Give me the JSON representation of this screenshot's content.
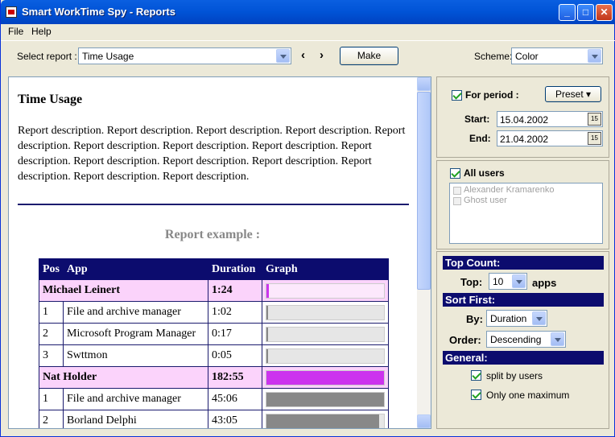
{
  "window": {
    "title": "Smart WorkTime Spy - Reports"
  },
  "menu": [
    "File",
    "Help"
  ],
  "toolbar": {
    "select_report_label": "Select report :",
    "report_value": "Time Usage",
    "prev_label": "‹",
    "next_label": "›",
    "make_label": "Make",
    "scheme_label": "Scheme:",
    "scheme_value": "Color"
  },
  "report": {
    "title": "Time Usage",
    "description": "Report description. Report description. Report description. Report description. Report description. Report description. Report description. Report description. Report description. Report description. Report description. Report description. Report description. Report description. Report description.",
    "example_title": "Report example :",
    "columns": [
      "Pos",
      "App",
      "Duration",
      "Graph"
    ],
    "rows": [
      {
        "type": "user",
        "pos": "",
        "app": "Michael Leinert",
        "duration": "1:24",
        "graph_fraction": 0.02,
        "color": "#cc33ee"
      },
      {
        "type": "app",
        "pos": "1",
        "app": "File and archive manager",
        "duration": "1:02",
        "graph_fraction": 0.01,
        "color": "#888888"
      },
      {
        "type": "app",
        "pos": "2",
        "app": "Microsoft Program Manager",
        "duration": "0:17",
        "graph_fraction": 0.01,
        "color": "#888888"
      },
      {
        "type": "app",
        "pos": "3",
        "app": "Swttmon",
        "duration": "0:05",
        "graph_fraction": 0.01,
        "color": "#888888"
      },
      {
        "type": "user",
        "pos": "",
        "app": "Nat Holder",
        "duration": "182:55",
        "graph_fraction": 1.0,
        "color": "#cc33ee"
      },
      {
        "type": "app",
        "pos": "1",
        "app": "File and archive manager",
        "duration": "45:06",
        "graph_fraction": 1.0,
        "color": "#888888"
      },
      {
        "type": "app",
        "pos": "2",
        "app": "Borland Delphi",
        "duration": "43:05",
        "graph_fraction": 0.96,
        "color": "#888888"
      }
    ]
  },
  "period": {
    "checkbox_label": "For period :",
    "checked": true,
    "preset_label": "Preset",
    "start_label": "Start:",
    "start_value": "15.04.2002",
    "end_label": "End:",
    "end_value": "21.04.2002"
  },
  "users": {
    "checkbox_label": "All users",
    "checked": true,
    "items": [
      "Alexander Kramarenko",
      "Ghost user"
    ]
  },
  "top_count": {
    "header": "Top Count:",
    "top_label": "Top:",
    "top_value": "10",
    "apps_label": "apps"
  },
  "sort_first": {
    "header": "Sort First:",
    "by_label": "By:",
    "by_value": "Duration",
    "order_label": "Order:",
    "order_value": "Descending"
  },
  "general": {
    "header": "General:",
    "split_label": "split by users",
    "split_checked": true,
    "one_max_label": "Only one maximum",
    "one_max_checked": true
  }
}
